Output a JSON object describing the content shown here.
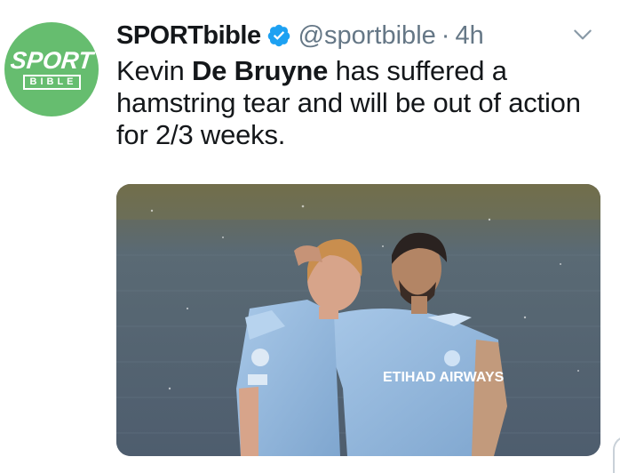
{
  "account": {
    "display_name": "SPORTbible",
    "handle": "@sportbible",
    "separator": "·",
    "time": "4h",
    "avatar_word_top": "SPORT",
    "avatar_word_bottom": "BIBLE",
    "avatar_color": "#66bd6f",
    "verified_color": "#1da1f2"
  },
  "tweet": {
    "text_1": "Kevin ",
    "text_bold": "De Bruyne",
    "text_2": " has suffered a hamstring tear and will be out of action for 2/3 weeks."
  },
  "media": {
    "sponsor_text": "ETIHAD AIRWAYS",
    "icons": [
      "verified-badge-icon",
      "chevron-down-icon"
    ]
  }
}
